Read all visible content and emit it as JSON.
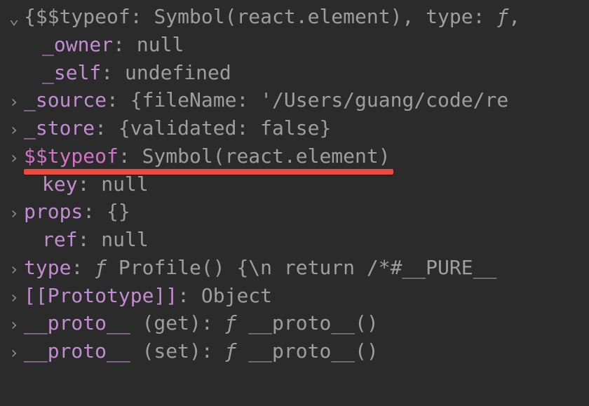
{
  "arrows": {
    "down": "⌄",
    "right": "›"
  },
  "line1": {
    "t1": "{",
    "k1": "$$typeof",
    "sep": ": ",
    "v1": "Symbol(react.element)",
    "comma": ", ",
    "k2": "type",
    "sep2": ": ",
    "v2": "ƒ",
    "trail": ","
  },
  "owner": {
    "key": "_owner",
    "sep": ": ",
    "val": "null"
  },
  "self": {
    "key": "_self",
    "sep": ": ",
    "val": "undefined"
  },
  "source": {
    "key": "_source",
    "sep": ": ",
    "pre": "{",
    "k1": "fileName",
    "s1": ": ",
    "v1": "'/Users/guang/code/re"
  },
  "store": {
    "key": "_store",
    "sep": ": ",
    "pre": "{",
    "k1": "validated",
    "s1": ": ",
    "v1": "false",
    "post": "}"
  },
  "typeof": {
    "key": "$$typeof",
    "sep": ": ",
    "val": "Symbol(react.element)"
  },
  "keyline": {
    "key": "key",
    "sep": ": ",
    "val": "null"
  },
  "props": {
    "key": "props",
    "sep": ": ",
    "val": "{}"
  },
  "ref": {
    "key": "ref",
    "sep": ": ",
    "val": "null"
  },
  "type": {
    "key": "type",
    "sep": ": ",
    "f": "ƒ ",
    "val": "Profile() {\\n  return /*#__PURE__"
  },
  "proto": {
    "key": "[[Prototype]]",
    "sep": ": ",
    "val": "Object"
  },
  "pget": {
    "key": "__proto__",
    "paren": " (get)",
    "sep": ": ",
    "f": "ƒ ",
    "val": "__proto__()"
  },
  "pset": {
    "key": "__proto__",
    "paren": " (set)",
    "sep": ": ",
    "f": "ƒ ",
    "val": "__proto__()"
  }
}
